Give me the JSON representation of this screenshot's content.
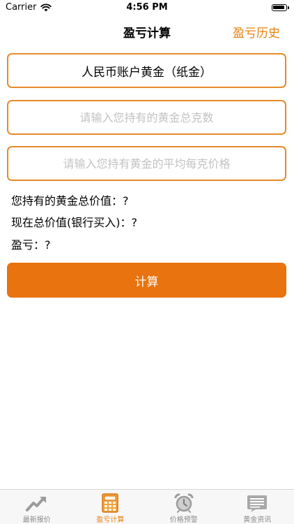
{
  "status_bar": {
    "carrier": "Carrier",
    "time": "4:56 PM"
  },
  "nav": {
    "title": "盈亏计算",
    "history_button": "盈亏历史"
  },
  "form": {
    "account_type": "人民币账户黄金（纸金）",
    "grams_placeholder": "请输入您持有的黄金总克数",
    "price_placeholder": "请输入您持有黄金的平均每克价格"
  },
  "results": {
    "total_value": "您持有的黄金总价值：?",
    "current_value": "现在总价值(银行买入)：?",
    "profit_loss": "盈亏：?"
  },
  "actions": {
    "calculate": "计算"
  },
  "tabs": [
    {
      "label": "最新报价",
      "icon": "chart-up-icon"
    },
    {
      "label": "盈亏计算",
      "icon": "calculator-icon",
      "active": true
    },
    {
      "label": "价格预警",
      "icon": "alarm-clock-icon"
    },
    {
      "label": "黄金资讯",
      "icon": "news-icon"
    }
  ],
  "colors": {
    "accent": "#e8730f",
    "border": "#e8892b",
    "inactive": "#8a8a8a"
  }
}
